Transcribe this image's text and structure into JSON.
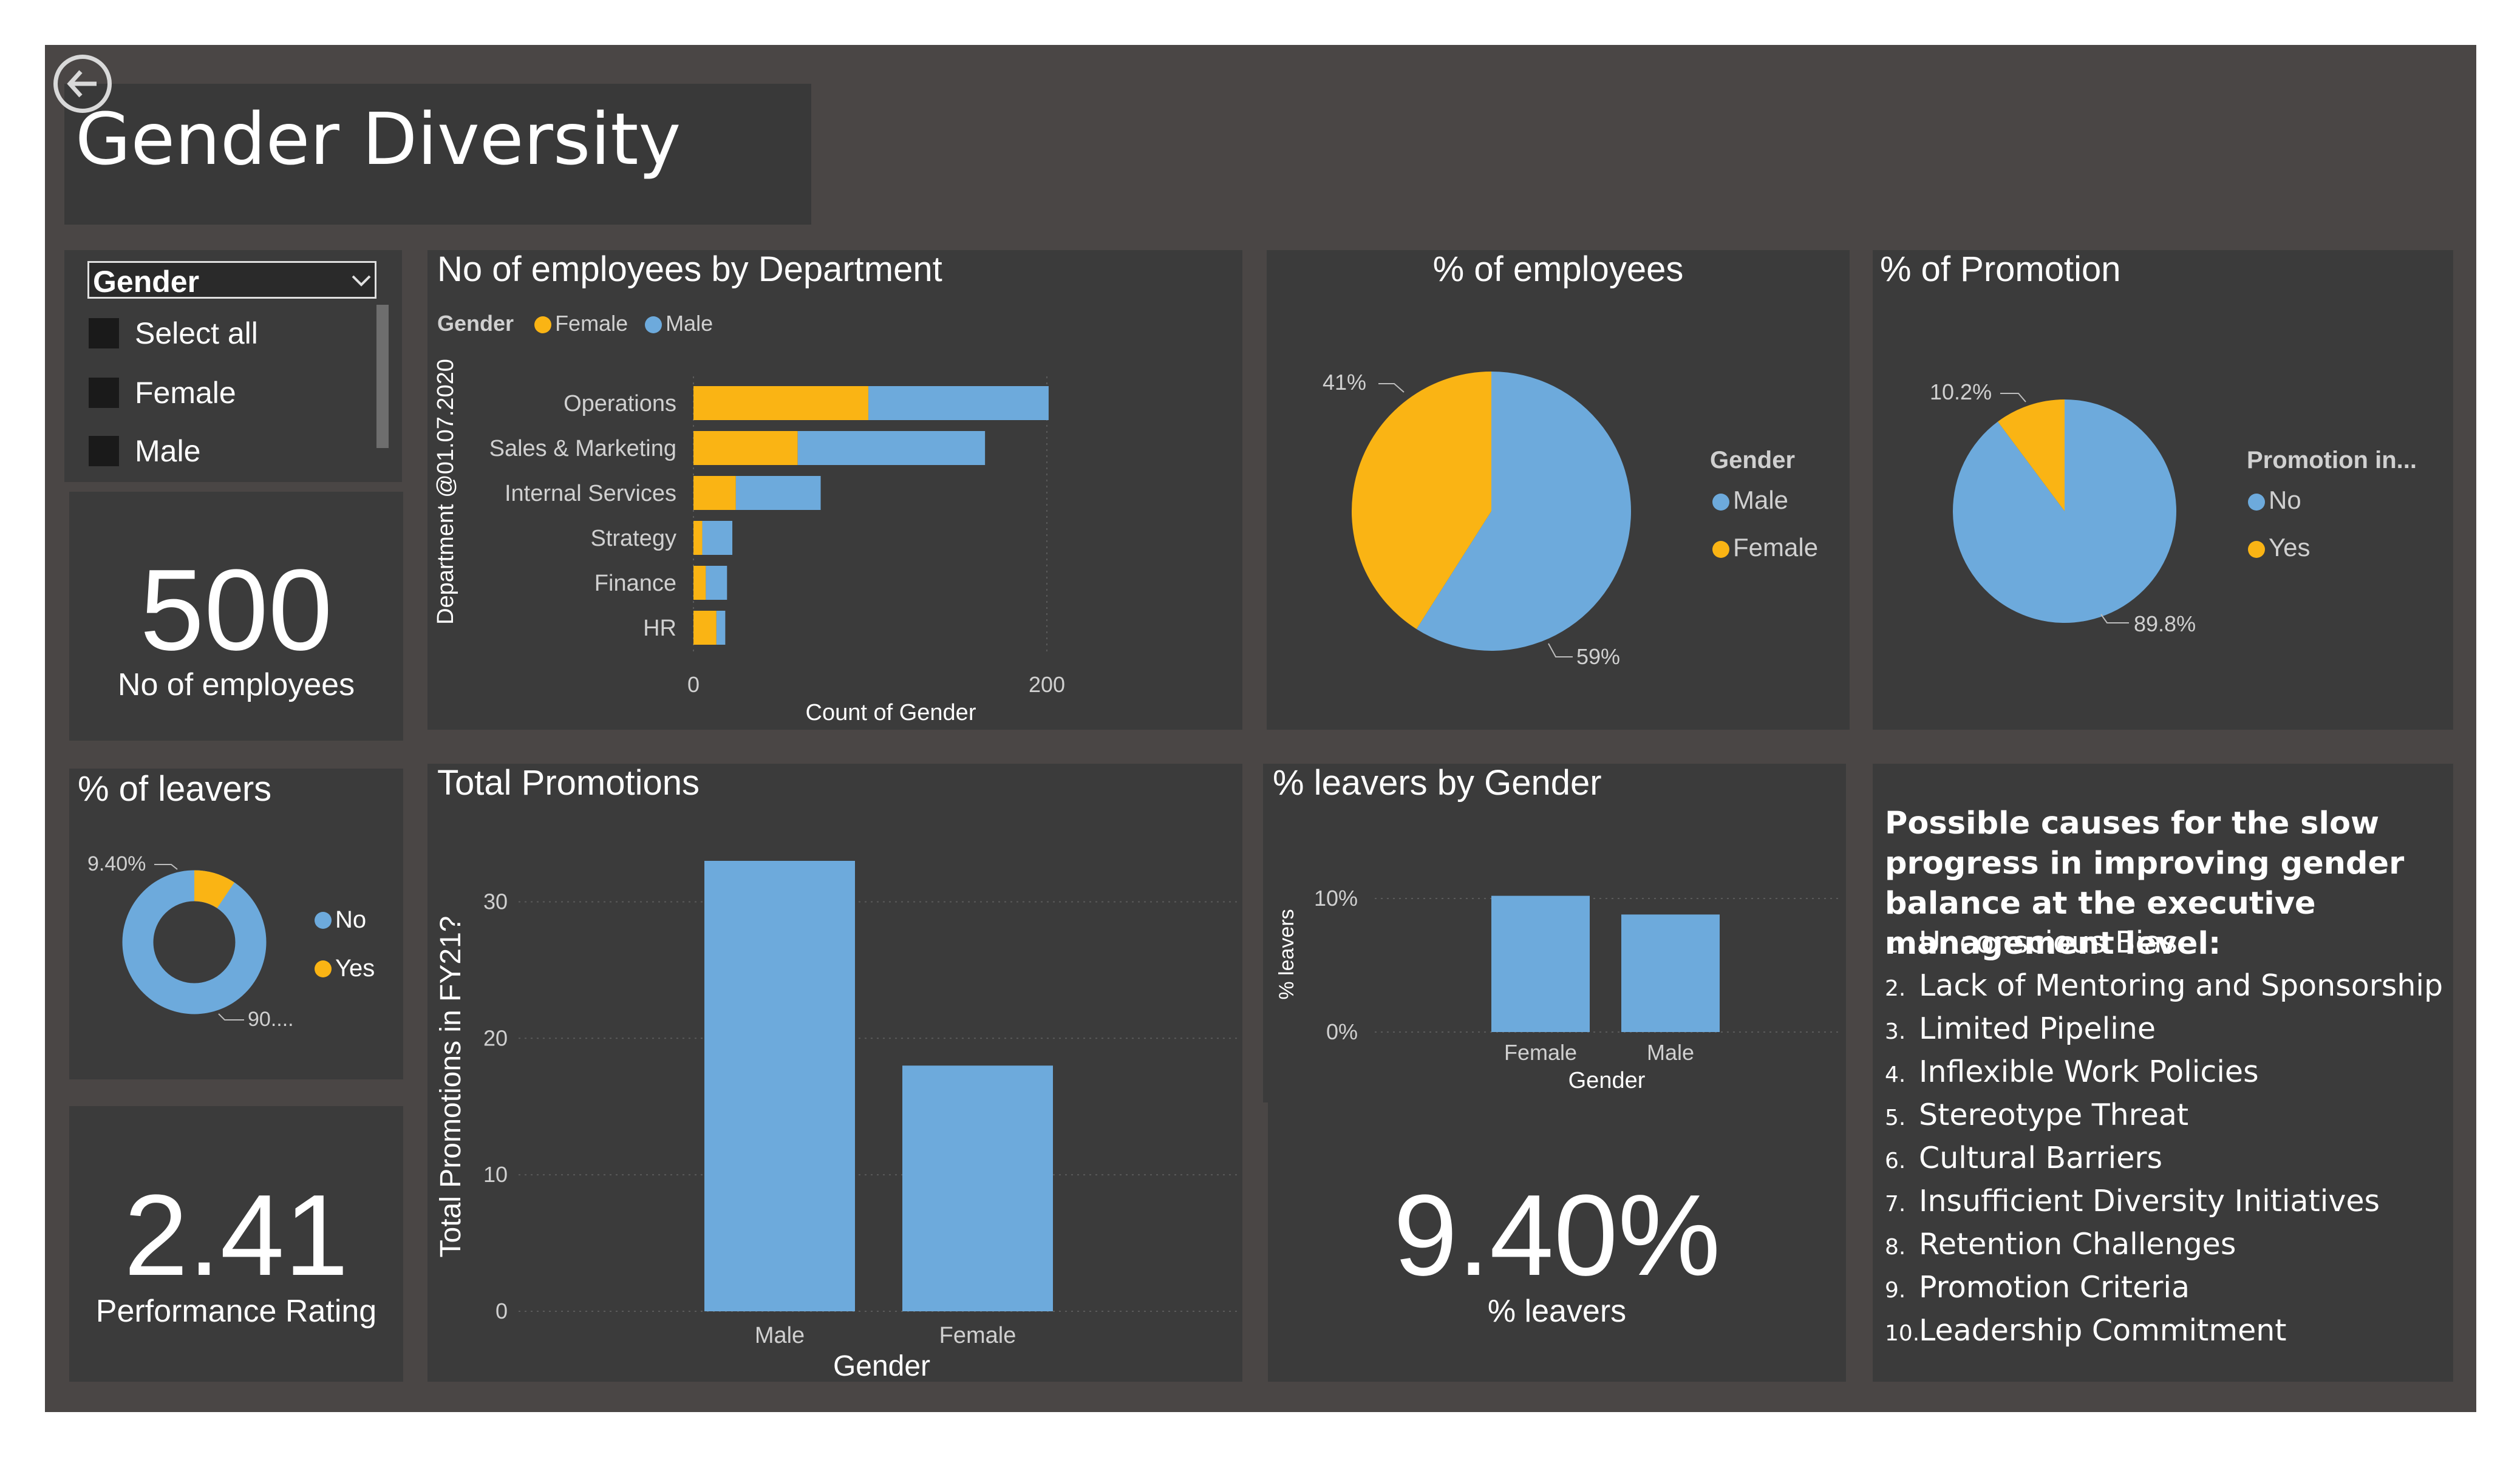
{
  "page": {
    "title": "Gender Diversity"
  },
  "colors": {
    "female": "#fab414",
    "male": "#6daadc",
    "background": "#4a4645",
    "card": "#3b3b3b"
  },
  "slicer": {
    "header": "Gender",
    "items": [
      {
        "label": "Select all"
      },
      {
        "label": "Female"
      },
      {
        "label": "Male"
      }
    ]
  },
  "kpi_employees": {
    "value": "500",
    "label": "No of employees"
  },
  "kpi_performance": {
    "value": "2.41",
    "label": "Performance Rating"
  },
  "kpi_leavers": {
    "value": "9.40%",
    "label": "% leavers"
  },
  "leavers_donut": {
    "title": "% of leavers",
    "yes_label": "9.40%",
    "no_label": "90....",
    "legend": [
      {
        "label": "No"
      },
      {
        "label": "Yes"
      }
    ]
  },
  "dept_chart": {
    "legend_title": "Gender",
    "legend": [
      {
        "label": "Female"
      },
      {
        "label": "Male"
      }
    ]
  },
  "emp_pie": {
    "legend_title": "Gender",
    "legend": [
      {
        "label": "Male"
      },
      {
        "label": "Female"
      }
    ]
  },
  "promo_pie": {
    "legend_title": "Promotion in...",
    "legend": [
      {
        "label": "No"
      },
      {
        "label": "Yes"
      }
    ]
  },
  "causes": {
    "title": "Possible causes for the slow progress in improving gender balance at the executive management level:",
    "items": [
      "Unconscious Bias",
      "Lack of Mentoring and Sponsorship",
      "Limited Pipeline",
      "Inflexible Work Policies",
      "Stereotype Threat",
      "Cultural Barriers",
      "Insufficient Diversity Initiatives",
      "Retention Challenges",
      "Promotion Criteria",
      "Leadership Commitment"
    ]
  },
  "chart_data": [
    {
      "id": "dept",
      "type": "bar",
      "orientation": "horizontal",
      "stacked": true,
      "title": "No of employees by Department",
      "xlabel": "Count of Gender",
      "ylabel": "Department @01.07.2020",
      "categories": [
        "Operations",
        "Sales & Marketing",
        "Internal Services",
        "Strategy",
        "Finance",
        "HR"
      ],
      "series": [
        {
          "name": "Female",
          "values": [
            99,
            59,
            24,
            5,
            7,
            13
          ]
        },
        {
          "name": "Male",
          "values": [
            102,
            106,
            48,
            17,
            12,
            5
          ]
        }
      ],
      "xlim": [
        0,
        200
      ],
      "xticks": [
        "0",
        "200"
      ]
    },
    {
      "id": "emp",
      "type": "pie",
      "title": "% of employees",
      "labels": [
        "Male",
        "Female"
      ],
      "values": [
        59,
        41
      ],
      "value_labels": [
        "59%",
        "41%"
      ]
    },
    {
      "id": "promo",
      "type": "pie",
      "title": "% of Promotion",
      "labels": [
        "No",
        "Yes"
      ],
      "values": [
        89.8,
        10.2
      ],
      "value_labels": [
        "89.8%",
        "10.2%"
      ]
    },
    {
      "id": "leavers",
      "type": "pie",
      "donut": true,
      "title": "% of leavers",
      "labels": [
        "No",
        "Yes"
      ],
      "values": [
        90.6,
        9.4
      ]
    },
    {
      "id": "promotions",
      "type": "bar",
      "title": "Total Promotions",
      "xlabel": "Gender",
      "ylabel": "Total Promotions in FY21?",
      "categories": [
        "Male",
        "Female"
      ],
      "values": [
        33,
        18
      ],
      "ylim": [
        0,
        33
      ],
      "yticks": [
        "0",
        "10",
        "20",
        "30"
      ]
    },
    {
      "id": "leavers_gender",
      "type": "bar",
      "title": "% leavers by Gender",
      "xlabel": "Gender",
      "ylabel": "% leavers",
      "categories": [
        "Female",
        "Male"
      ],
      "values": [
        10.2,
        8.8
      ],
      "ylim": [
        0,
        10
      ],
      "yticks": [
        "0%",
        "10%"
      ]
    }
  ]
}
